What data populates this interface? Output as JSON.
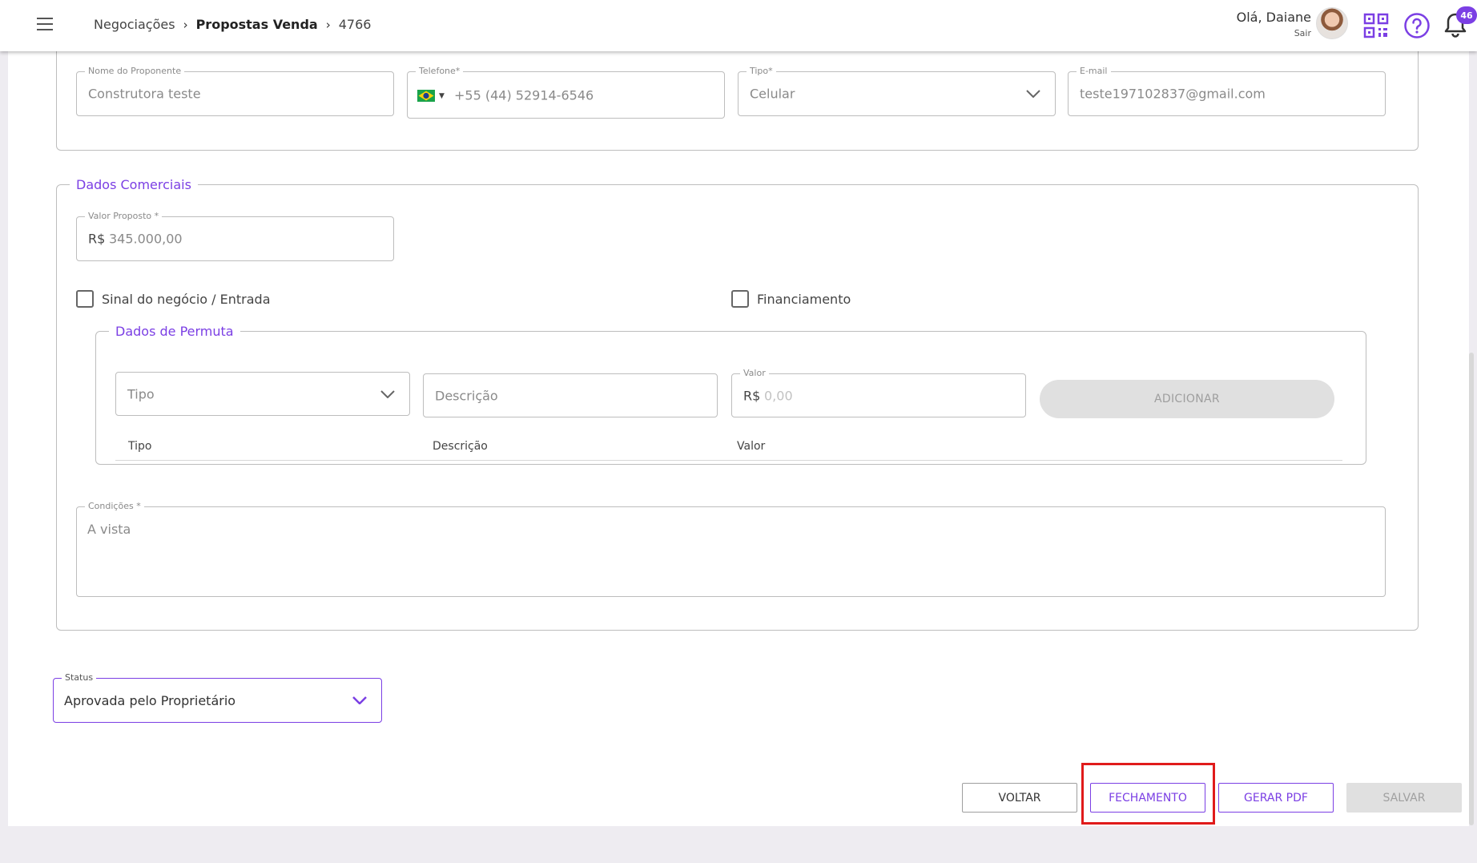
{
  "header": {
    "breadcrumb": [
      "Negociações",
      "Propostas Venda",
      "4766"
    ],
    "greeting": "Olá, Daiane",
    "logout": "Sair",
    "notifications_count": "46"
  },
  "proponent": {
    "name_label": "Nome do Proponente",
    "name_value": "Construtora teste",
    "phone_label": "Telefone*",
    "phone_value": "+55 (44) 52914-6546",
    "type_label": "Tipo*",
    "type_value": "Celular",
    "email_label": "E-mail",
    "email_value": "teste197102837@gmail.com"
  },
  "commercial": {
    "legend": "Dados Comerciais",
    "value_label": "Valor Proposto *",
    "currency": "R$",
    "value": "345.000,00",
    "checkbox_entry": "Sinal do negócio / Entrada",
    "checkbox_financing": "Financiamento"
  },
  "exchange": {
    "legend": "Dados de Permuta",
    "type_placeholder": "Tipo",
    "description_placeholder": "Descrição",
    "value_label": "Valor",
    "currency": "R$",
    "value_placeholder": "0,00",
    "add_button": "ADICIONAR",
    "columns": [
      "Tipo",
      "Descrição",
      "Valor"
    ]
  },
  "conditions": {
    "label": "Condições *",
    "value": "A vista"
  },
  "status": {
    "label": "Status",
    "value": "Aprovada pelo Proprietário"
  },
  "actions": {
    "back": "VOLTAR",
    "closing": "FECHAMENTO",
    "pdf": "GERAR PDF",
    "save": "SALVAR"
  },
  "colors": {
    "accent": "#7b3fe4",
    "highlight": "#e01b1b"
  }
}
